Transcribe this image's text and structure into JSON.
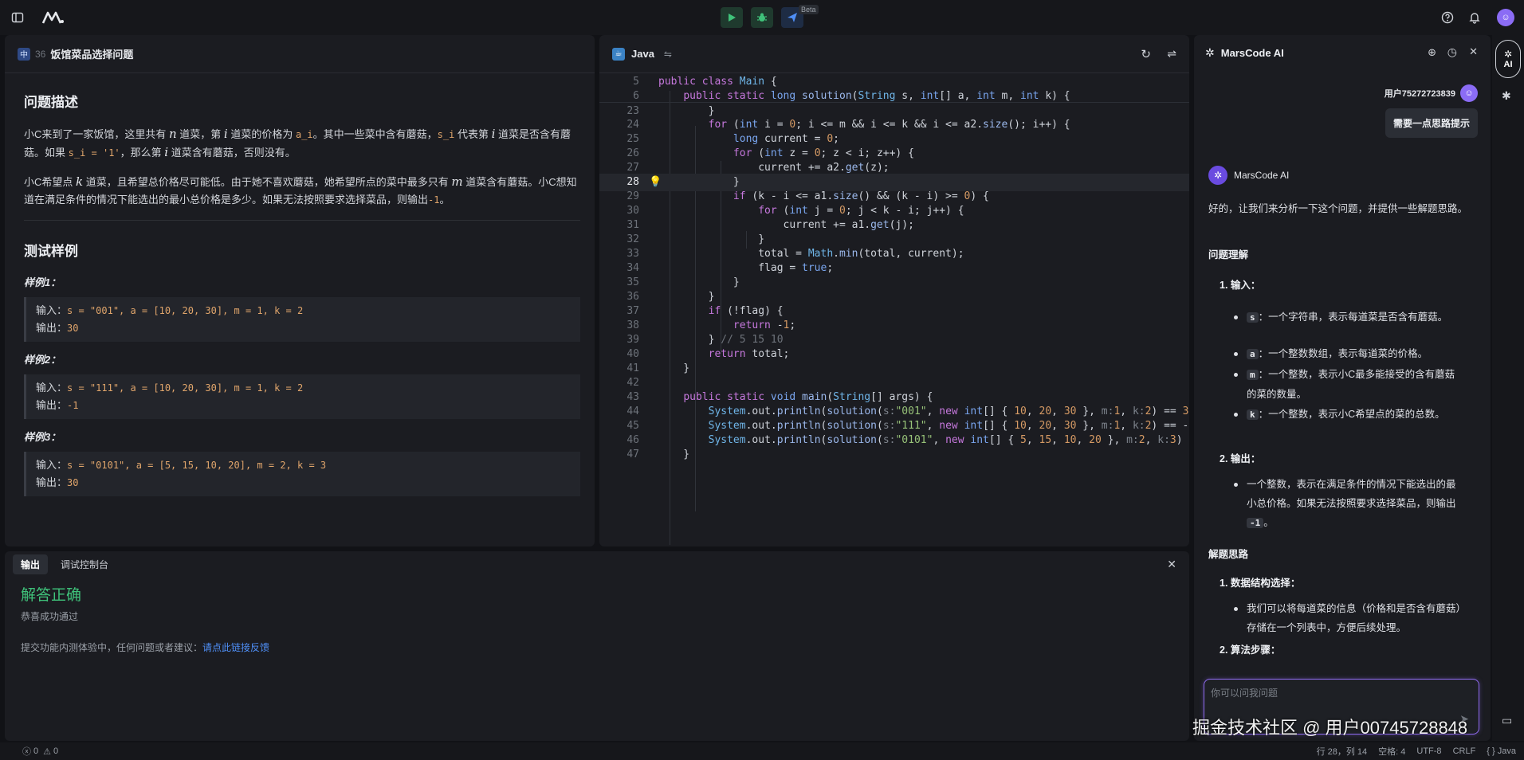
{
  "topbar": {
    "beta": "Beta",
    "avatar": "☺"
  },
  "problem": {
    "badge": "中",
    "id": "36",
    "title": "饭馆菜品选择问题",
    "desc_heading": "问题描述",
    "p1_a": "小C来到了一家饭馆，这里共有 ",
    "p1_var_n": "n",
    "p1_b": " 道菜，第 ",
    "p1_var_i": "i",
    "p1_c": " 道菜的价格为 ",
    "p1_code_ai": "a_i",
    "p1_d": "。其中一些菜中含有蘑菇，",
    "p1_code_si": "s_i",
    "p1_e": " 代表第 ",
    "p1_var_i2": "i",
    "p1_f": " 道菜是否含有蘑菇。如果 ",
    "p1_code_si1": "s_i = '1'",
    "p1_g": "，那么第 ",
    "p1_var_i3": "i",
    "p1_h": " 道菜含有蘑菇，否则没有。",
    "p2_a": "小C希望点 ",
    "p2_var_k": "k",
    "p2_b": " 道菜，且希望总价格尽可能低。由于她不喜欢蘑菇，她希望所点的菜中最多只有 ",
    "p2_var_m": "m",
    "p2_c": " 道菜含有蘑菇。小C想知道在满足条件的情况下能选出的最小总价格是多少。如果无法按照要求选择菜品，则输出",
    "p2_code": "-1",
    "p2_d": "。",
    "test_heading": "测试样例",
    "samples": [
      {
        "title": "样例1：",
        "in_label": "输入：",
        "in": "s = \"001\", a = [10, 20, 30], m = 1, k = 2",
        "out_label": "输出：",
        "out": "30"
      },
      {
        "title": "样例2：",
        "in_label": "输入：",
        "in": "s = \"111\", a = [10, 20, 30], m = 1, k = 2",
        "out_label": "输出：",
        "out": "-1"
      },
      {
        "title": "样例3：",
        "in_label": "输入：",
        "in": "s = \"0101\", a = [5, 15, 10, 20], m = 2, k = 3",
        "out_label": "输出：",
        "out": "30"
      }
    ]
  },
  "editor": {
    "language": "Java",
    "line_numbers": [
      "5",
      "6",
      "23",
      "24",
      "25",
      "26",
      "27",
      "28",
      "29",
      "30",
      "31",
      "32",
      "33",
      "34",
      "35",
      "36",
      "37",
      "38",
      "39",
      "40",
      "41",
      "42",
      "43",
      "44",
      "45",
      "46",
      "47"
    ]
  },
  "output": {
    "tab_output": "输出",
    "tab_debug": "调试控制台",
    "result": "解答正确",
    "result_sub": "恭喜成功通过",
    "feedback_text": "提交功能内测体验中，任何问题或者建议：",
    "feedback_link": "请点此链接反馈"
  },
  "ai": {
    "title": "MarsCode AI",
    "user_name": "用户75272723839",
    "user_message": "需要一点思路提示",
    "bot_name": "MarsCode AI",
    "intro": "好的，让我们来分析一下这个问题，并提供一些解题思路。",
    "sec1": "问题理解",
    "item_input": "1. 输入：",
    "s_chip": "s",
    "s_desc": "：一个字符串，表示每道菜是否含有蘑菇。",
    "a_chip": "a",
    "a_desc": "：一个整数数组，表示每道菜的价格。",
    "m_chip": "m",
    "m_desc": "：一个整数，表示小C最多能接受的含有蘑菇的菜的数量。",
    "k_chip": "k",
    "k_desc": "：一个整数，表示小C希望点的菜的总数。",
    "item_output": "2. 输出：",
    "out_desc_a": "一个整数，表示在满足条件的情况下能选出的最小总价格。如果无法按照要求选择菜品，则输出 ",
    "out_chip": "-1",
    "out_desc_b": "。",
    "sec2": "解题思路",
    "item_ds": "1. 数据结构选择：",
    "ds_desc": "我们可以将每道菜的信息（价格和是否含有蘑菇）存储在一个列表中，方便后续处理。",
    "item_algo": "2. 算法步骤：",
    "input_placeholder": "你可以问我问题"
  },
  "rail": {
    "ai_label": "AI"
  },
  "status": {
    "errors": "0",
    "warnings": "0",
    "position": "行 28，列 14",
    "spaces": "空格: 4",
    "encoding": "UTF-8",
    "eol": "CRLF",
    "lang": "{ } Java"
  },
  "watermark": "掘金技术社区 @ 用户00745728848"
}
